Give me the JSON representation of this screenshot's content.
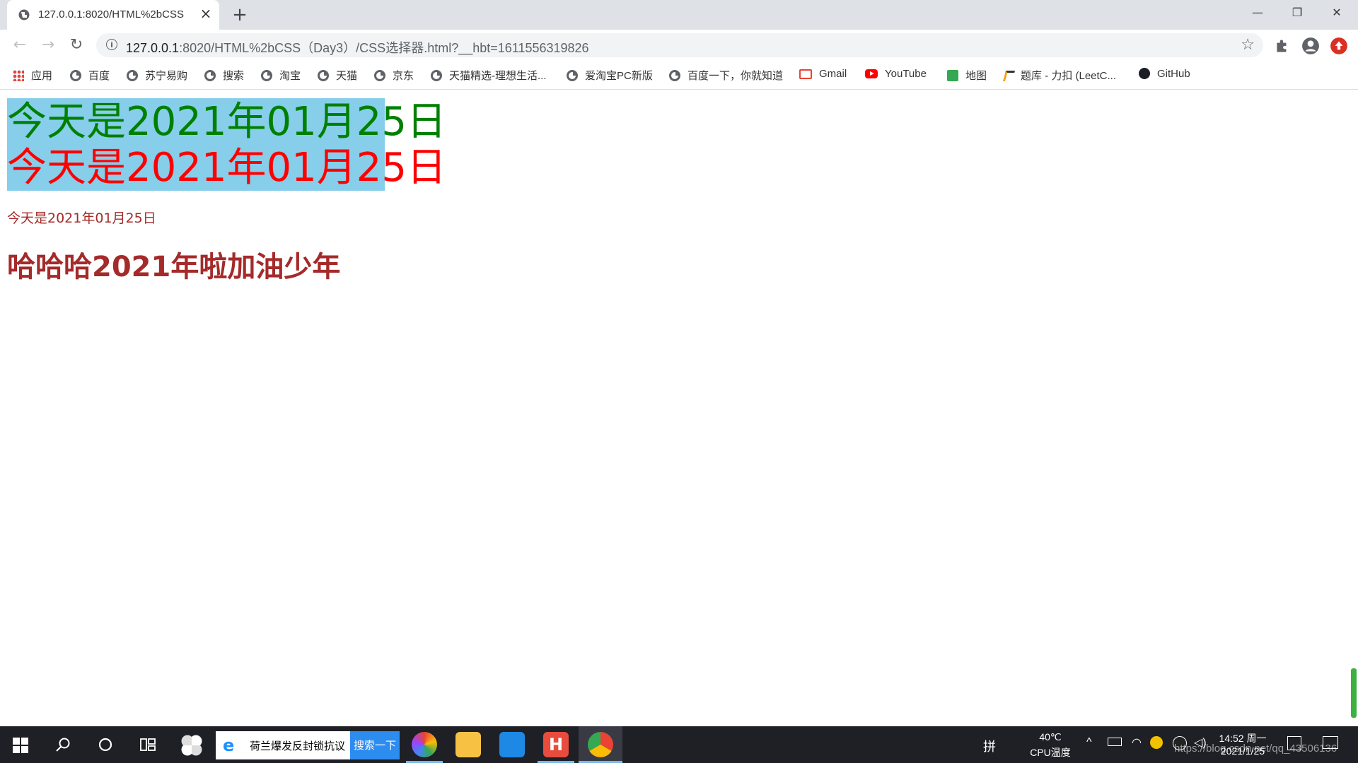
{
  "window": {
    "tab_title": "127.0.0.1:8020/HTML%2bCSS",
    "close_tab": "×",
    "new_tab": "+",
    "minimize": "—",
    "restore": "❐",
    "close": "✕"
  },
  "toolbar": {
    "back": "←",
    "forward": "→",
    "reload": "↻",
    "url_host": "127.0.0.1",
    "url_path": ":8020/HTML%2bCSS（Day3）/CSS选择器.html?__hbt=1611556319826",
    "star": "☆"
  },
  "bookmarks": [
    {
      "label": "应用",
      "icon": "apps-grid-icon"
    },
    {
      "label": "百度",
      "icon": "globe-icon"
    },
    {
      "label": "苏宁易购",
      "icon": "globe-icon"
    },
    {
      "label": "搜索",
      "icon": "globe-icon"
    },
    {
      "label": "淘宝",
      "icon": "globe-icon"
    },
    {
      "label": "天猫",
      "icon": "globe-icon"
    },
    {
      "label": "京东",
      "icon": "globe-icon"
    },
    {
      "label": "天猫精选-理想生活...",
      "icon": "globe-icon"
    },
    {
      "label": "爱淘宝PC新版",
      "icon": "globe-icon"
    },
    {
      "label": "百度一下，你就知道",
      "icon": "globe-icon"
    },
    {
      "label": "Gmail",
      "icon": "gmail-icon"
    },
    {
      "label": "YouTube",
      "icon": "youtube-icon"
    },
    {
      "label": "地图",
      "icon": "maps-icon"
    },
    {
      "label": "题库 - 力扣 (LeetC...",
      "icon": "leetcode-icon"
    },
    {
      "label": "GitHub",
      "icon": "github-icon"
    }
  ],
  "page": {
    "line1": "今天是2021年01月25日",
    "line2": "今天是2021年01月25日",
    "small_text": "今天是2021年01月25日",
    "bold_text": "哈哈哈2021年啦加油少年",
    "colors": {
      "highlight_bg": "#87ceeb",
      "line1": "#008000",
      "line2": "#ff0000",
      "brown": "#a52a2a"
    }
  },
  "taskbar": {
    "search_text": "荷兰爆发反封锁抗议",
    "search_button": "搜索一下",
    "ime": "拼",
    "temp": "40℃",
    "temp_label": "CPU温度",
    "time": "14:52 周一",
    "date": "2021/1/25"
  },
  "watermark": "https://blog.csdn.net/qq_43506136"
}
